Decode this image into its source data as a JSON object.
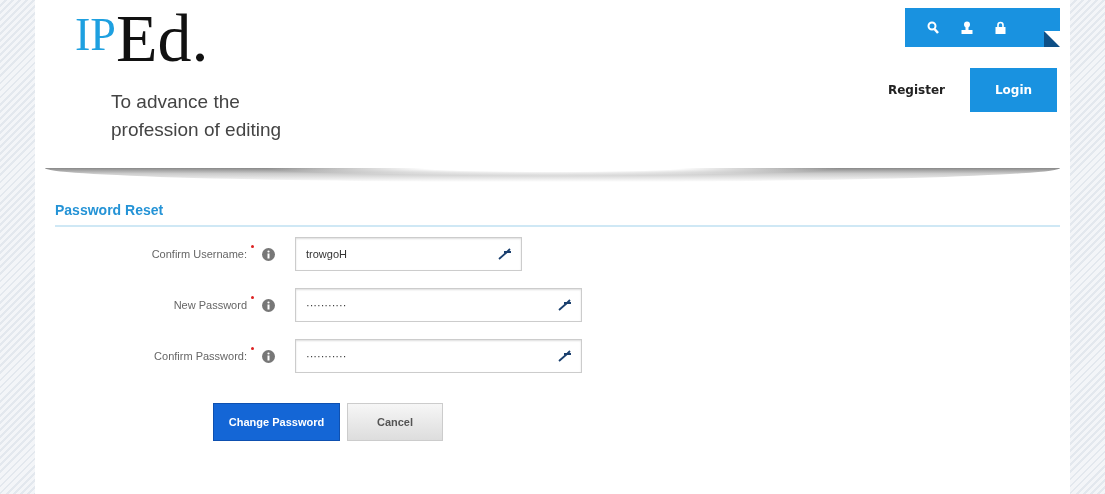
{
  "logo": {
    "prefix": "IP",
    "suffix": "Ed."
  },
  "tagline": "To advance the profession of editing",
  "toolbar": [
    {
      "kind": "search"
    },
    {
      "kind": "user"
    },
    {
      "kind": "lock"
    }
  ],
  "header_links": {
    "register": "Register",
    "login": "Login"
  },
  "form": {
    "title": "Password Reset",
    "fields": [
      {
        "label": "Confirm Username:",
        "required": true,
        "value": "trowgoH",
        "wide": false
      },
      {
        "label": "New Password",
        "required": true,
        "value": "···········",
        "wide": true
      },
      {
        "label": "Confirm Password:",
        "required": true,
        "value": "···········",
        "wide": true
      }
    ],
    "buttons": [
      {
        "label": "Change Password",
        "kind": "primary"
      },
      {
        "label": "Cancel",
        "kind": "secondary"
      }
    ]
  }
}
